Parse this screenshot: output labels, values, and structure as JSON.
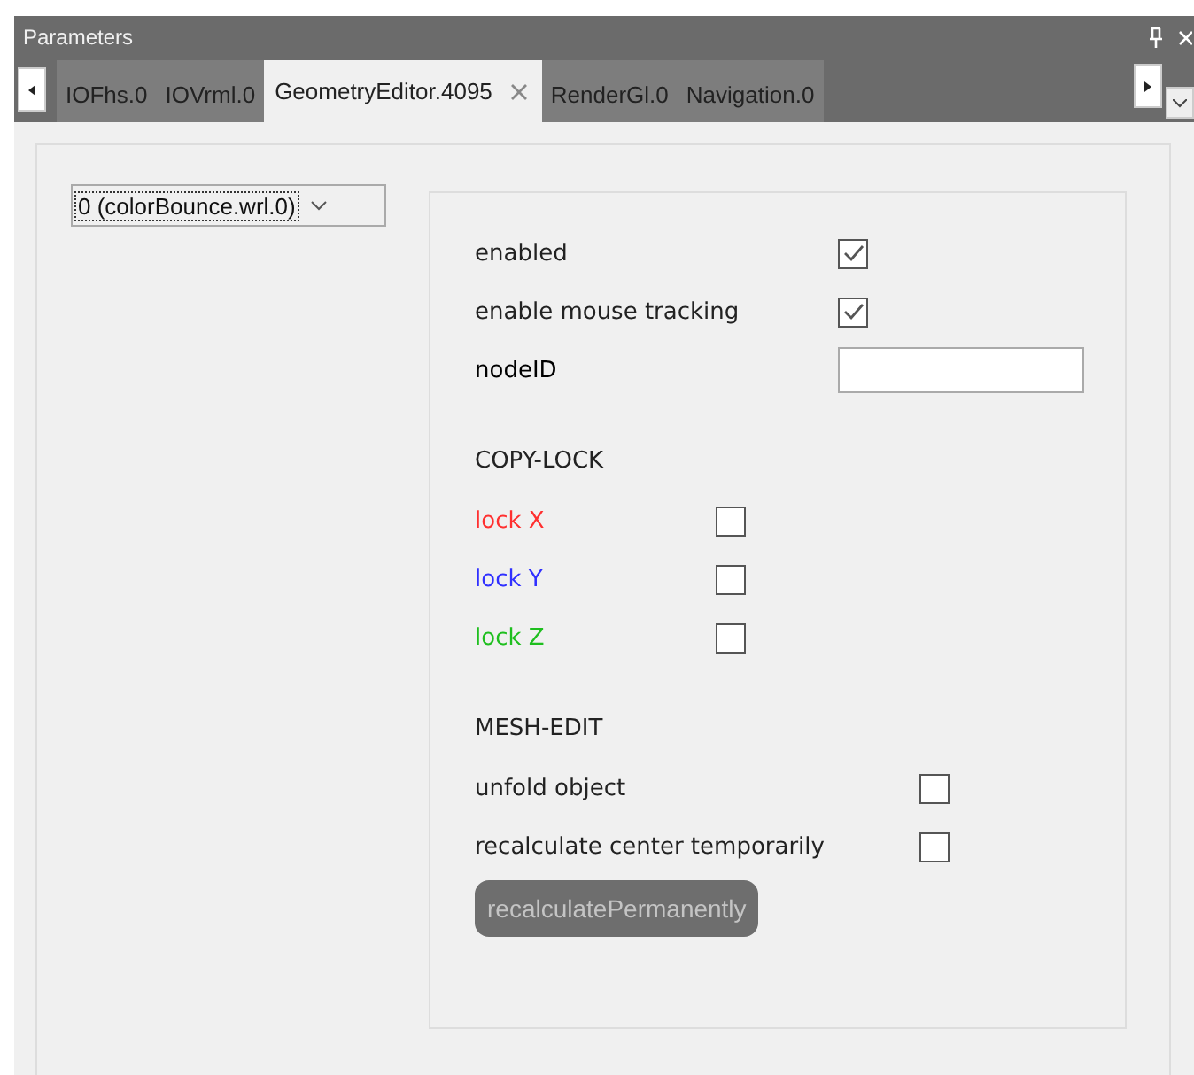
{
  "window": {
    "title": "Parameters"
  },
  "tabs": [
    {
      "label": "IOFhs.0",
      "selected": false
    },
    {
      "label": "IOVrml.0",
      "selected": false
    },
    {
      "label": "GeometryEditor.4095",
      "selected": true,
      "closable": true
    },
    {
      "label": "RenderGl.0",
      "selected": false
    },
    {
      "label": "Navigation.0",
      "selected": false
    }
  ],
  "node_select": {
    "value": "0 (colorBounce.wrl.0)"
  },
  "sections": [
    {
      "rows": [
        {
          "kind": "checkbox",
          "label": "enabled",
          "checked": true
        },
        {
          "kind": "checkbox",
          "label": "enable mouse tracking",
          "checked": true
        },
        {
          "kind": "field",
          "label": "nodeID"
        }
      ]
    },
    {
      "heading": "COPY-LOCK",
      "rows": [
        {
          "kind": "checkbox",
          "label": "lock X",
          "checked": false,
          "color": "#ff3030"
        },
        {
          "kind": "checkbox",
          "label": "lock Y",
          "checked": false,
          "color": "#3030ff"
        },
        {
          "kind": "checkbox",
          "label": "lock Z",
          "checked": false,
          "color": "#1fbf1f"
        }
      ]
    },
    {
      "heading": "MESH-EDIT",
      "rows": [
        {
          "kind": "checkbox",
          "label": "unfold object",
          "checked": false
        },
        {
          "kind": "checkbox",
          "label": "recalculate center temporarily",
          "checked": false
        },
        {
          "kind": "button",
          "label": "recalculatePermanently",
          "disabled": true
        }
      ]
    }
  ]
}
